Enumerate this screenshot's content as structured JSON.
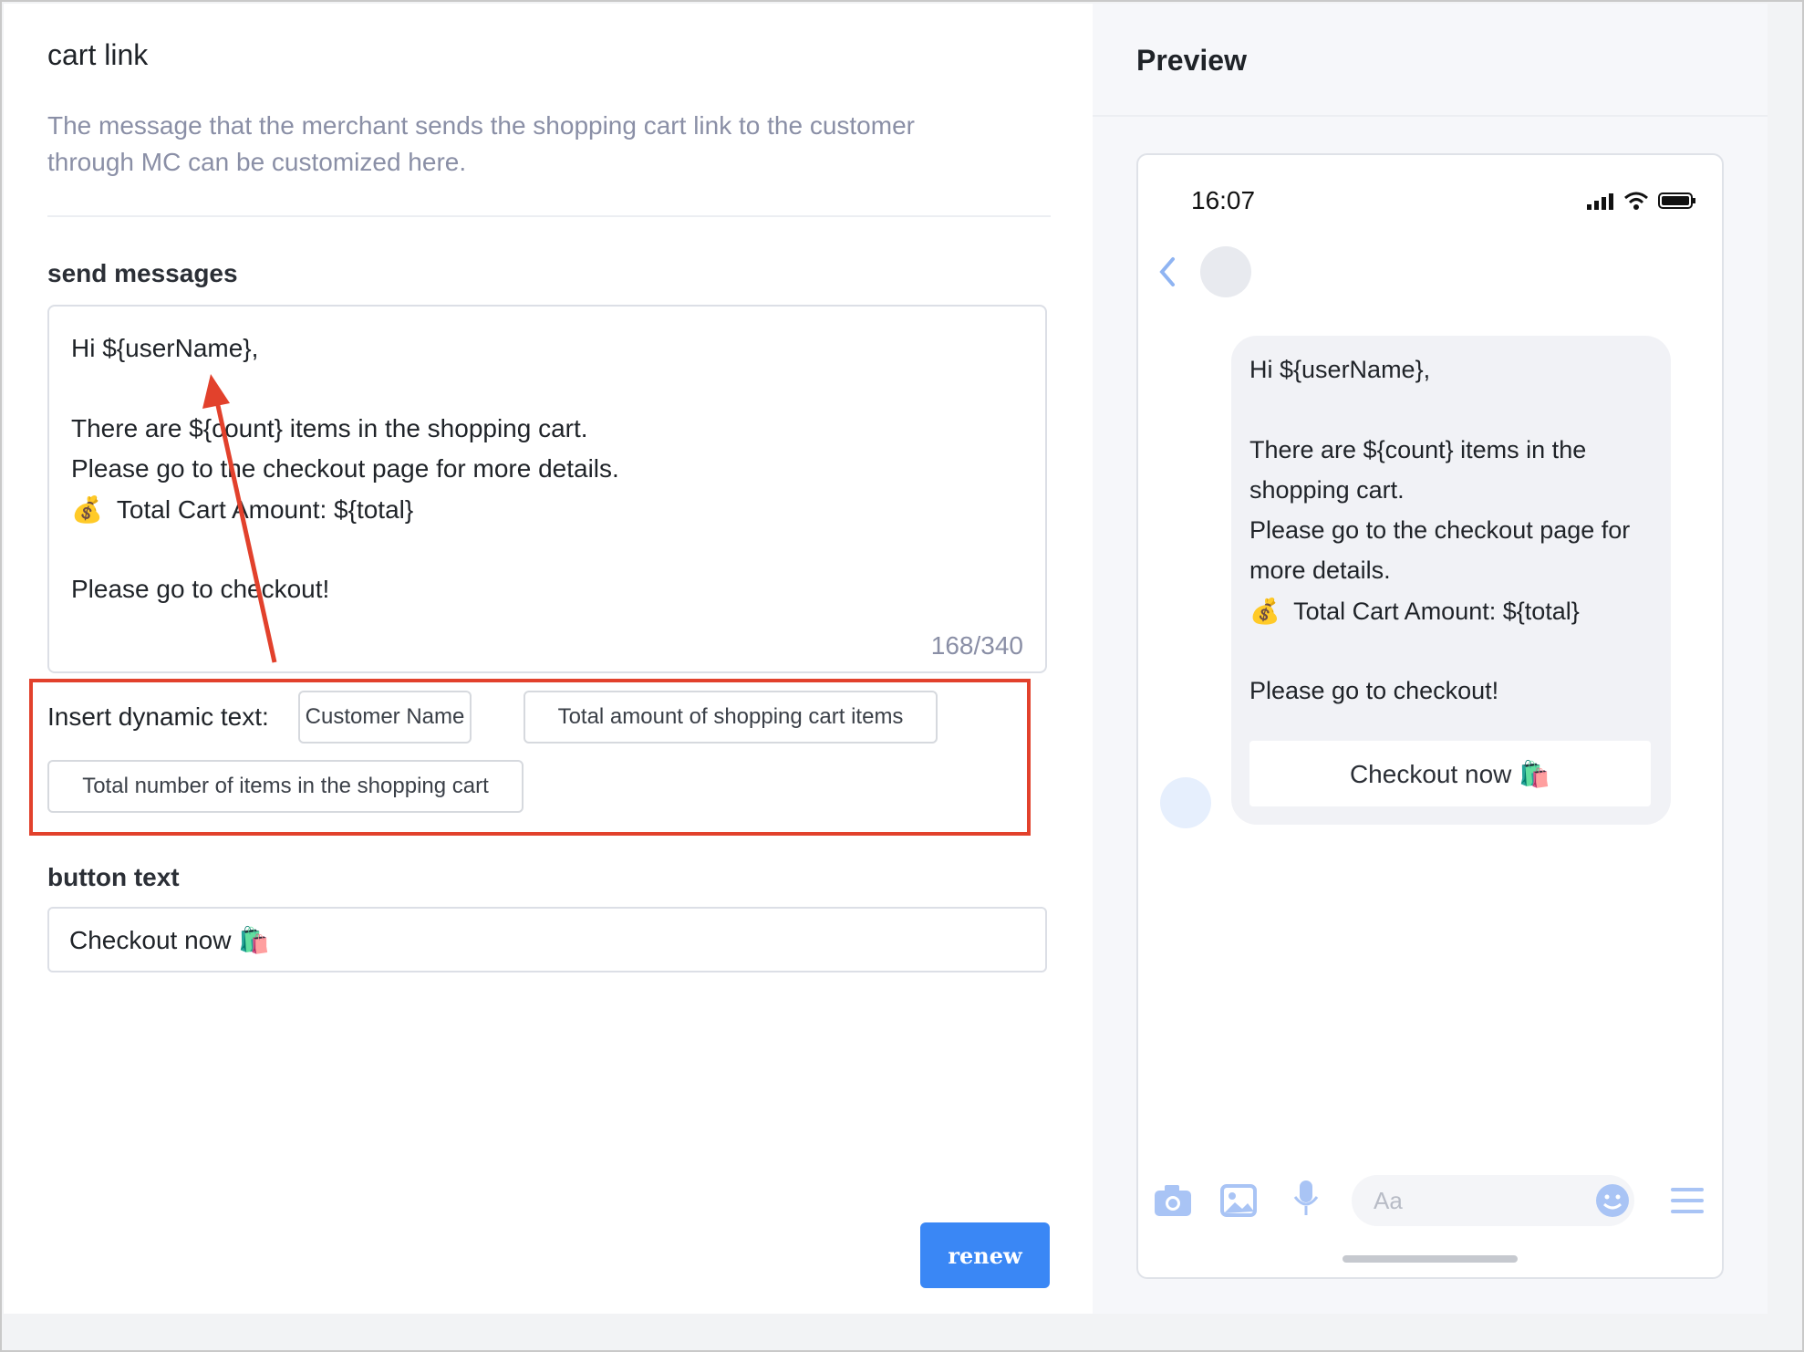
{
  "editor": {
    "title": "cart link",
    "description_line1": "The message that the merchant sends the shopping cart link to the customer",
    "description_line2": "through MC can be customized here.",
    "send_messages_label": "send messages",
    "message_lines": [
      "Hi ${userName},",
      "There are ${count} items in the shopping cart.",
      "Please go to the checkout page for more details.",
      "💰  Total Cart Amount: ${total}",
      "Please go to checkout!"
    ],
    "char_counter": "168/340",
    "insert_label": "Insert dynamic text:",
    "chips": [
      "Customer Name",
      "Total amount of shopping cart items",
      "Total number of items in the shopping cart"
    ],
    "button_text_label": "button text",
    "button_text_value": "Checkout now 🛍️",
    "renew_label": "renew"
  },
  "preview": {
    "title": "Preview",
    "time": "16:07",
    "bubble_lines": [
      "Hi ${userName},",
      "There are ${count} items in the",
      "shopping cart.",
      "Please go to the checkout page for",
      "more details.",
      "💰  Total Cart Amount: ${total}",
      "Please go to checkout!"
    ],
    "bubble_button": "Checkout now 🛍️",
    "input_placeholder": "Aa"
  },
  "colors": {
    "accent": "#3a87f5",
    "annotation_red": "#e2412c",
    "muted_text": "#8a8fa6",
    "icon_blue": "#a9c4f5"
  }
}
